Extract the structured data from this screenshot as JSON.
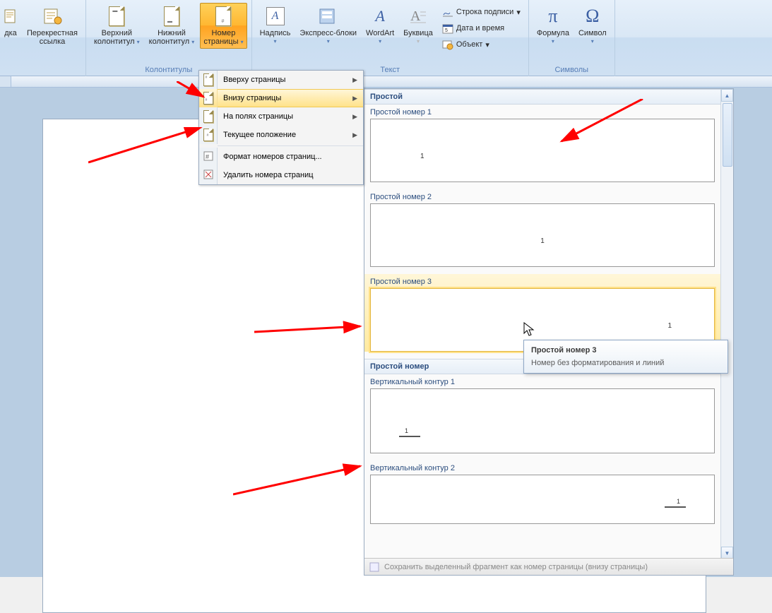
{
  "ribbon": {
    "links_group": {
      "cross_ref_line1_partial": "дка",
      "cross_ref_line2": "Перекрестная",
      "cross_ref_line3": "ссылка"
    },
    "headers_group": {
      "label": "Колонтитулы",
      "header_top": "Верхний",
      "header_top2": "колонтитул",
      "header_bottom": "Нижний",
      "header_bottom2": "колонтитул",
      "page_number": "Номер",
      "page_number2": "страницы"
    },
    "text_group": {
      "label": "Текст",
      "textbox": "Надпись",
      "quickparts": "Экспресс-блоки",
      "wordart": "WordArt",
      "dropcap": "Буквица",
      "sig_line": "Строка подписи",
      "date_time": "Дата и время",
      "object": "Объект"
    },
    "symbols_group": {
      "label": "Символы",
      "formula": "Формула",
      "symbol": "Символ"
    }
  },
  "dropdown": {
    "top_of_page": "Вверху страницы",
    "bottom_of_page": "Внизу страницы",
    "page_margins": "На полях страницы",
    "current_position": "Текущее положение",
    "format_numbers": "Формат номеров страниц...",
    "remove_numbers": "Удалить номера страниц"
  },
  "gallery": {
    "section_simple": "Простой",
    "item1": "Простой номер 1",
    "item2": "Простой номер 2",
    "item3": "Простой номер 3",
    "section_simple_number": "Простой номер",
    "item4": "Вертикальный контур 1",
    "item5": "Вертикальный контур 2",
    "preview_number": "1",
    "save_fragment": "Сохранить выделенный фрагмент как номер страницы (внизу страницы)"
  },
  "tooltip": {
    "title": "Простой номер 3",
    "desc": "Номер без форматирования и линий"
  }
}
